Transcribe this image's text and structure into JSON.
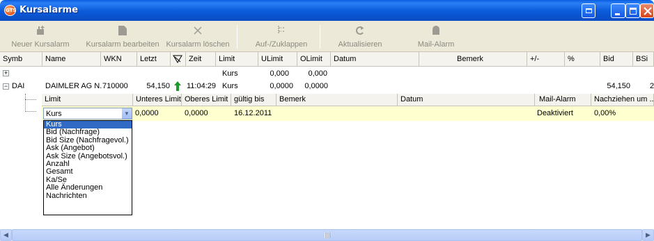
{
  "window": {
    "title": "Kursalarme",
    "app_icon_text": "GTS"
  },
  "toolbar": [
    {
      "label": "Neuer Kursalarm",
      "icon": "new-alarm-icon"
    },
    {
      "label": "Kursalarm bearbeiten",
      "icon": "edit-alarm-icon"
    },
    {
      "label": "Kursalarm löschen",
      "icon": "delete-icon"
    },
    {
      "label": "Auf-/Zuklappen",
      "icon": "collapse-icon"
    },
    {
      "label": "Aktualisieren",
      "icon": "refresh-icon"
    },
    {
      "label": "Mail-Alarm",
      "icon": "mail-alarm-icon"
    }
  ],
  "grid": {
    "columns": [
      "Symb",
      "Name",
      "WKN",
      "Letzt",
      "",
      "Zeit",
      "Limit",
      "ULimit",
      "OLimit",
      "Datum",
      "Bemerk",
      "+/-",
      "%",
      "Bid",
      "BSi"
    ],
    "rows": [
      {
        "symb": "",
        "name": "",
        "wkn": "",
        "letzt": "",
        "zeit": "",
        "limit": "Kurs",
        "ulimit": "0,000",
        "olimit": "0,000",
        "bid": ""
      },
      {
        "symb": "DAI",
        "name": "DAIMLER AG N.",
        "wkn": "710000",
        "letzt": "54,150",
        "zeit": "11:04:29",
        "limit": "Kurs",
        "ulimit": "0,0000",
        "olimit": "0,0000",
        "bid": "54,150",
        "bsi": "2"
      }
    ]
  },
  "subgrid": {
    "columns": [
      "Limit",
      "Unteres Limit",
      "Oberes Limit",
      "gültig bis",
      "Bemerk",
      "Datum",
      "Mail-Alarm",
      "Nachziehen um ..."
    ],
    "row": {
      "limit": "Kurs",
      "unteres": "0,0000",
      "oberes": "0,0000",
      "gueltig": "16.12.2011",
      "bemerk": "",
      "datum": "",
      "mail": "Deaktiviert",
      "nachziehen": "0,00%"
    }
  },
  "dropdown": {
    "options": [
      "Kurs",
      "Bid (Nachfrage)",
      "Bid Size (Nachfragevol.)",
      "Ask (Angebot)",
      "Ask Size (Angebotsvol.)",
      "Anzahl",
      "Gesamt",
      "Ka/Se",
      "Alle Änderungen",
      "Nachrichten"
    ],
    "selected": "Kurs"
  },
  "colors": {
    "title_bar": "#0a5ee0",
    "selected_row": "#ffffcf",
    "selection": "#316ac5",
    "trend_up": "#1a9a2a"
  }
}
